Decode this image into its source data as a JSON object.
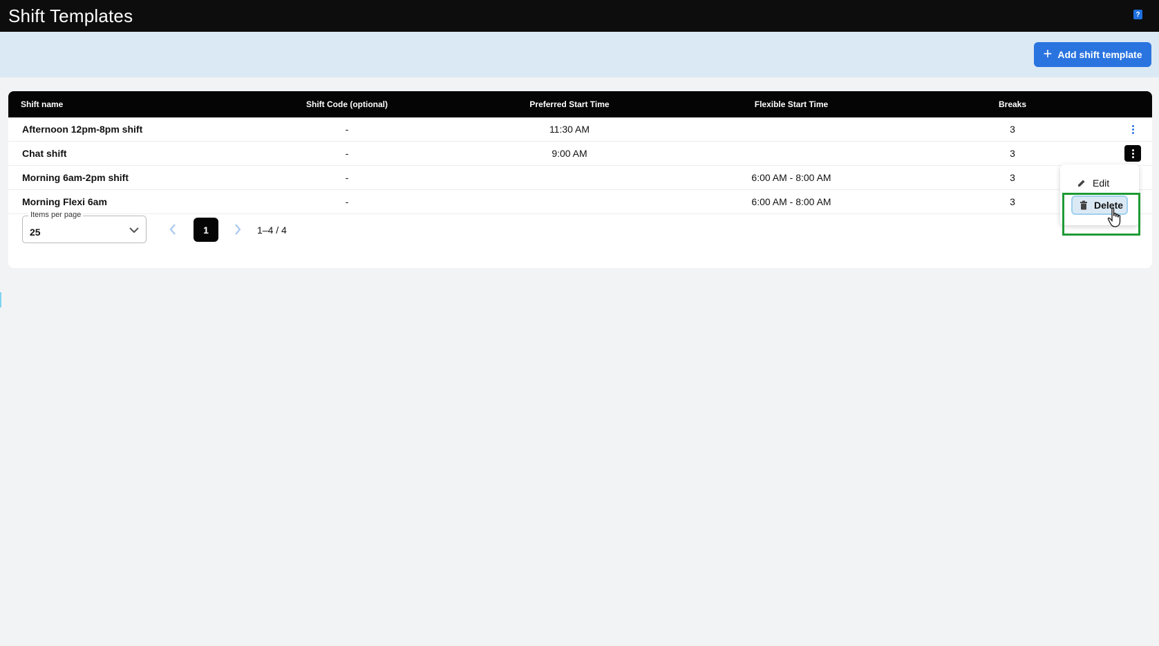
{
  "header": {
    "title": "Shift Templates",
    "help_icon": "help-icon"
  },
  "actions": {
    "add_label": "Add shift template"
  },
  "table": {
    "columns": [
      "Shift name",
      "Shift Code (optional)",
      "Preferred Start Time",
      "Flexible Start Time",
      "Breaks"
    ],
    "rows": [
      {
        "name": "Afternoon 12pm-8pm shift",
        "code": "-",
        "preferred": "11:30 AM",
        "flexible": "",
        "breaks": "3"
      },
      {
        "name": "Chat shift",
        "code": "-",
        "preferred": "9:00 AM",
        "flexible": "",
        "breaks": "3"
      },
      {
        "name": "Morning 6am-2pm shift",
        "code": "-",
        "preferred": "",
        "flexible": "6:00 AM - 8:00 AM",
        "breaks": "3"
      },
      {
        "name": "Morning Flexi 6am",
        "code": "-",
        "preferred": "",
        "flexible": "6:00 AM - 8:00 AM",
        "breaks": "3"
      }
    ]
  },
  "pagination": {
    "items_per_page_label": "Items per page",
    "items_per_page_value": "25",
    "current_page": "1",
    "range": "1–4 / 4"
  },
  "context_menu": {
    "edit": "Edit",
    "delete": "Delete"
  },
  "colors": {
    "primary": "#2a74e0",
    "header_bg": "#0d0d0d",
    "highlight": "#1f9a34"
  }
}
